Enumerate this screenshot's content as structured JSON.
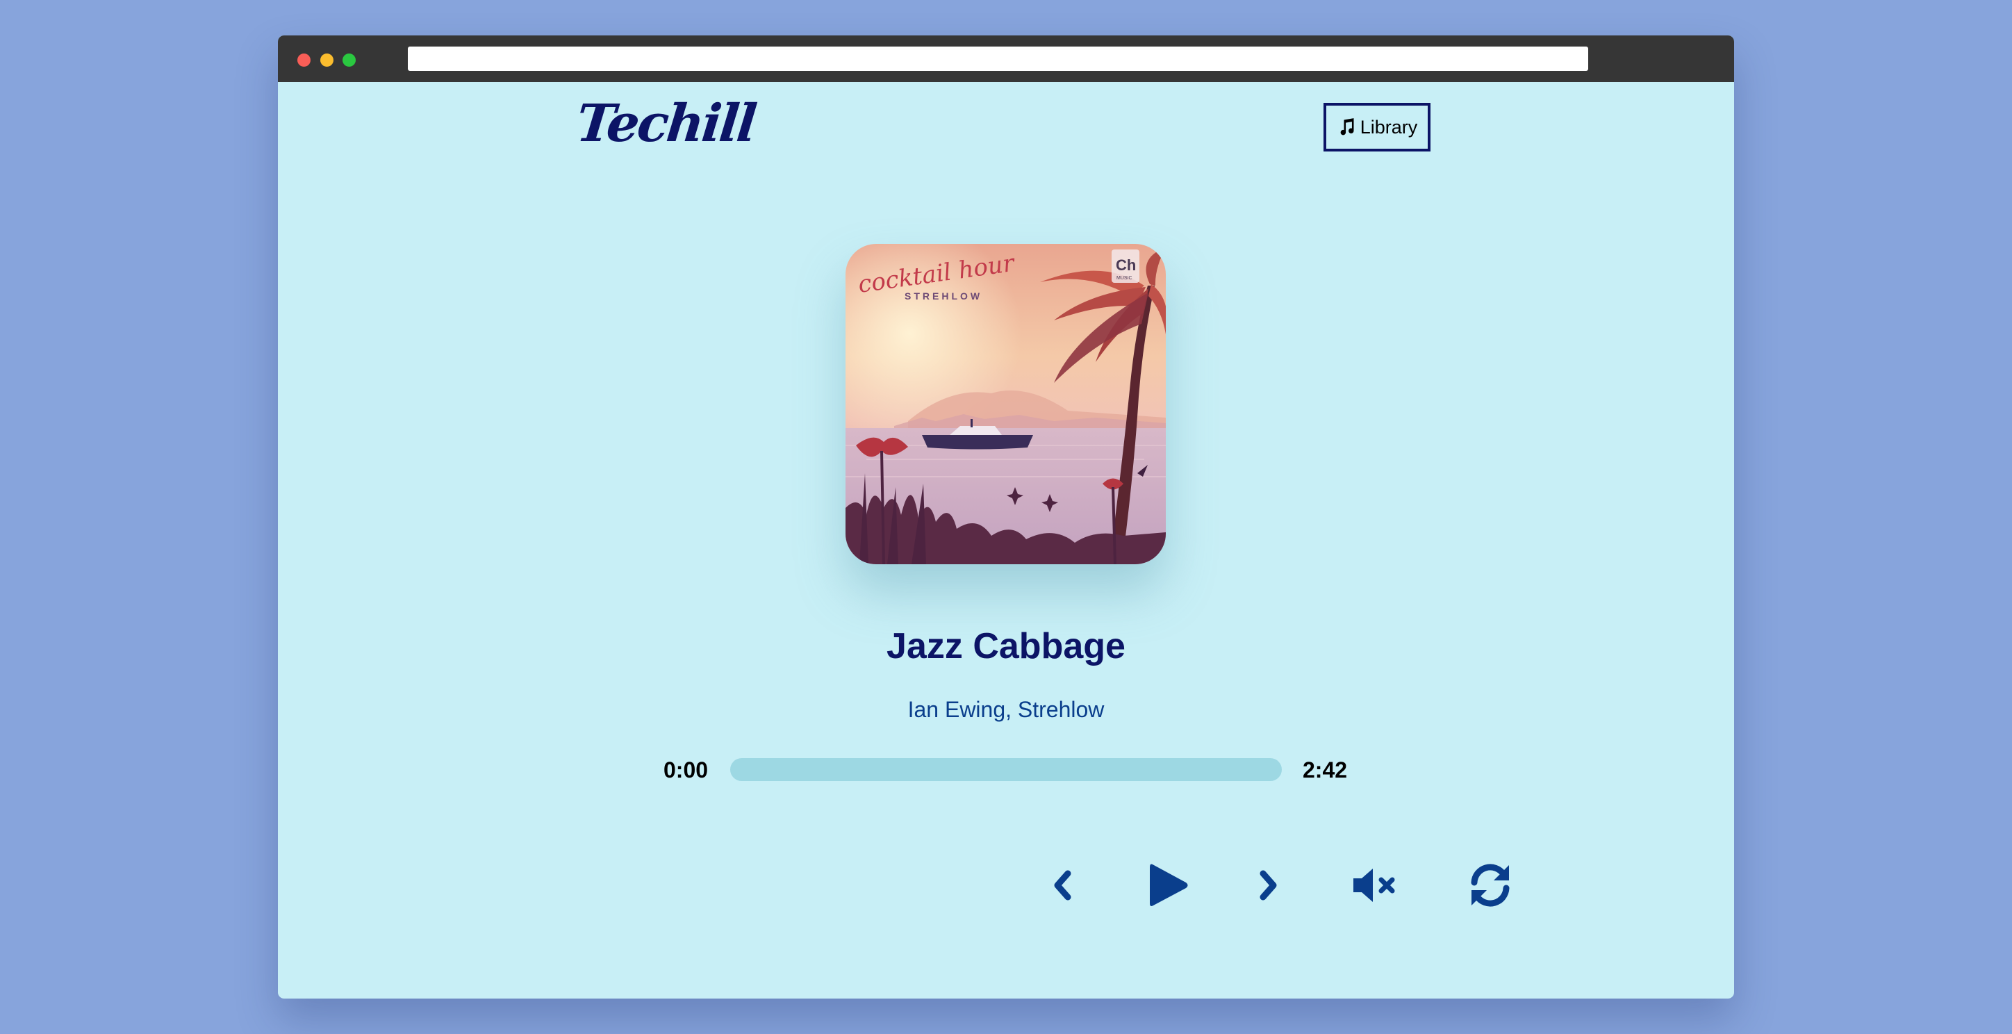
{
  "browser": {
    "url": ""
  },
  "header": {
    "logo_text": "Techill",
    "library_label": "Library"
  },
  "album": {
    "cover_title": "cocktail hour",
    "cover_artist": "STREHLOW",
    "cover_badge": "Ch",
    "cover_badge_sub": "MUSIC"
  },
  "track": {
    "title": "Jazz Cabbage",
    "artist": "Ian Ewing, Strehlow",
    "current_time": "0:00",
    "total_time": "2:42",
    "progress_fraction": 0
  },
  "controls": {
    "icons": [
      "chevron-left-icon",
      "play-icon",
      "chevron-right-icon",
      "volume-mute-icon",
      "repeat-icon"
    ]
  },
  "colors": {
    "background": "#87a4dc",
    "app_background": "#c8eff6",
    "primary_text": "#0c1466",
    "accent": "#0a3e8c",
    "progress_track": "#9dd8e3"
  }
}
